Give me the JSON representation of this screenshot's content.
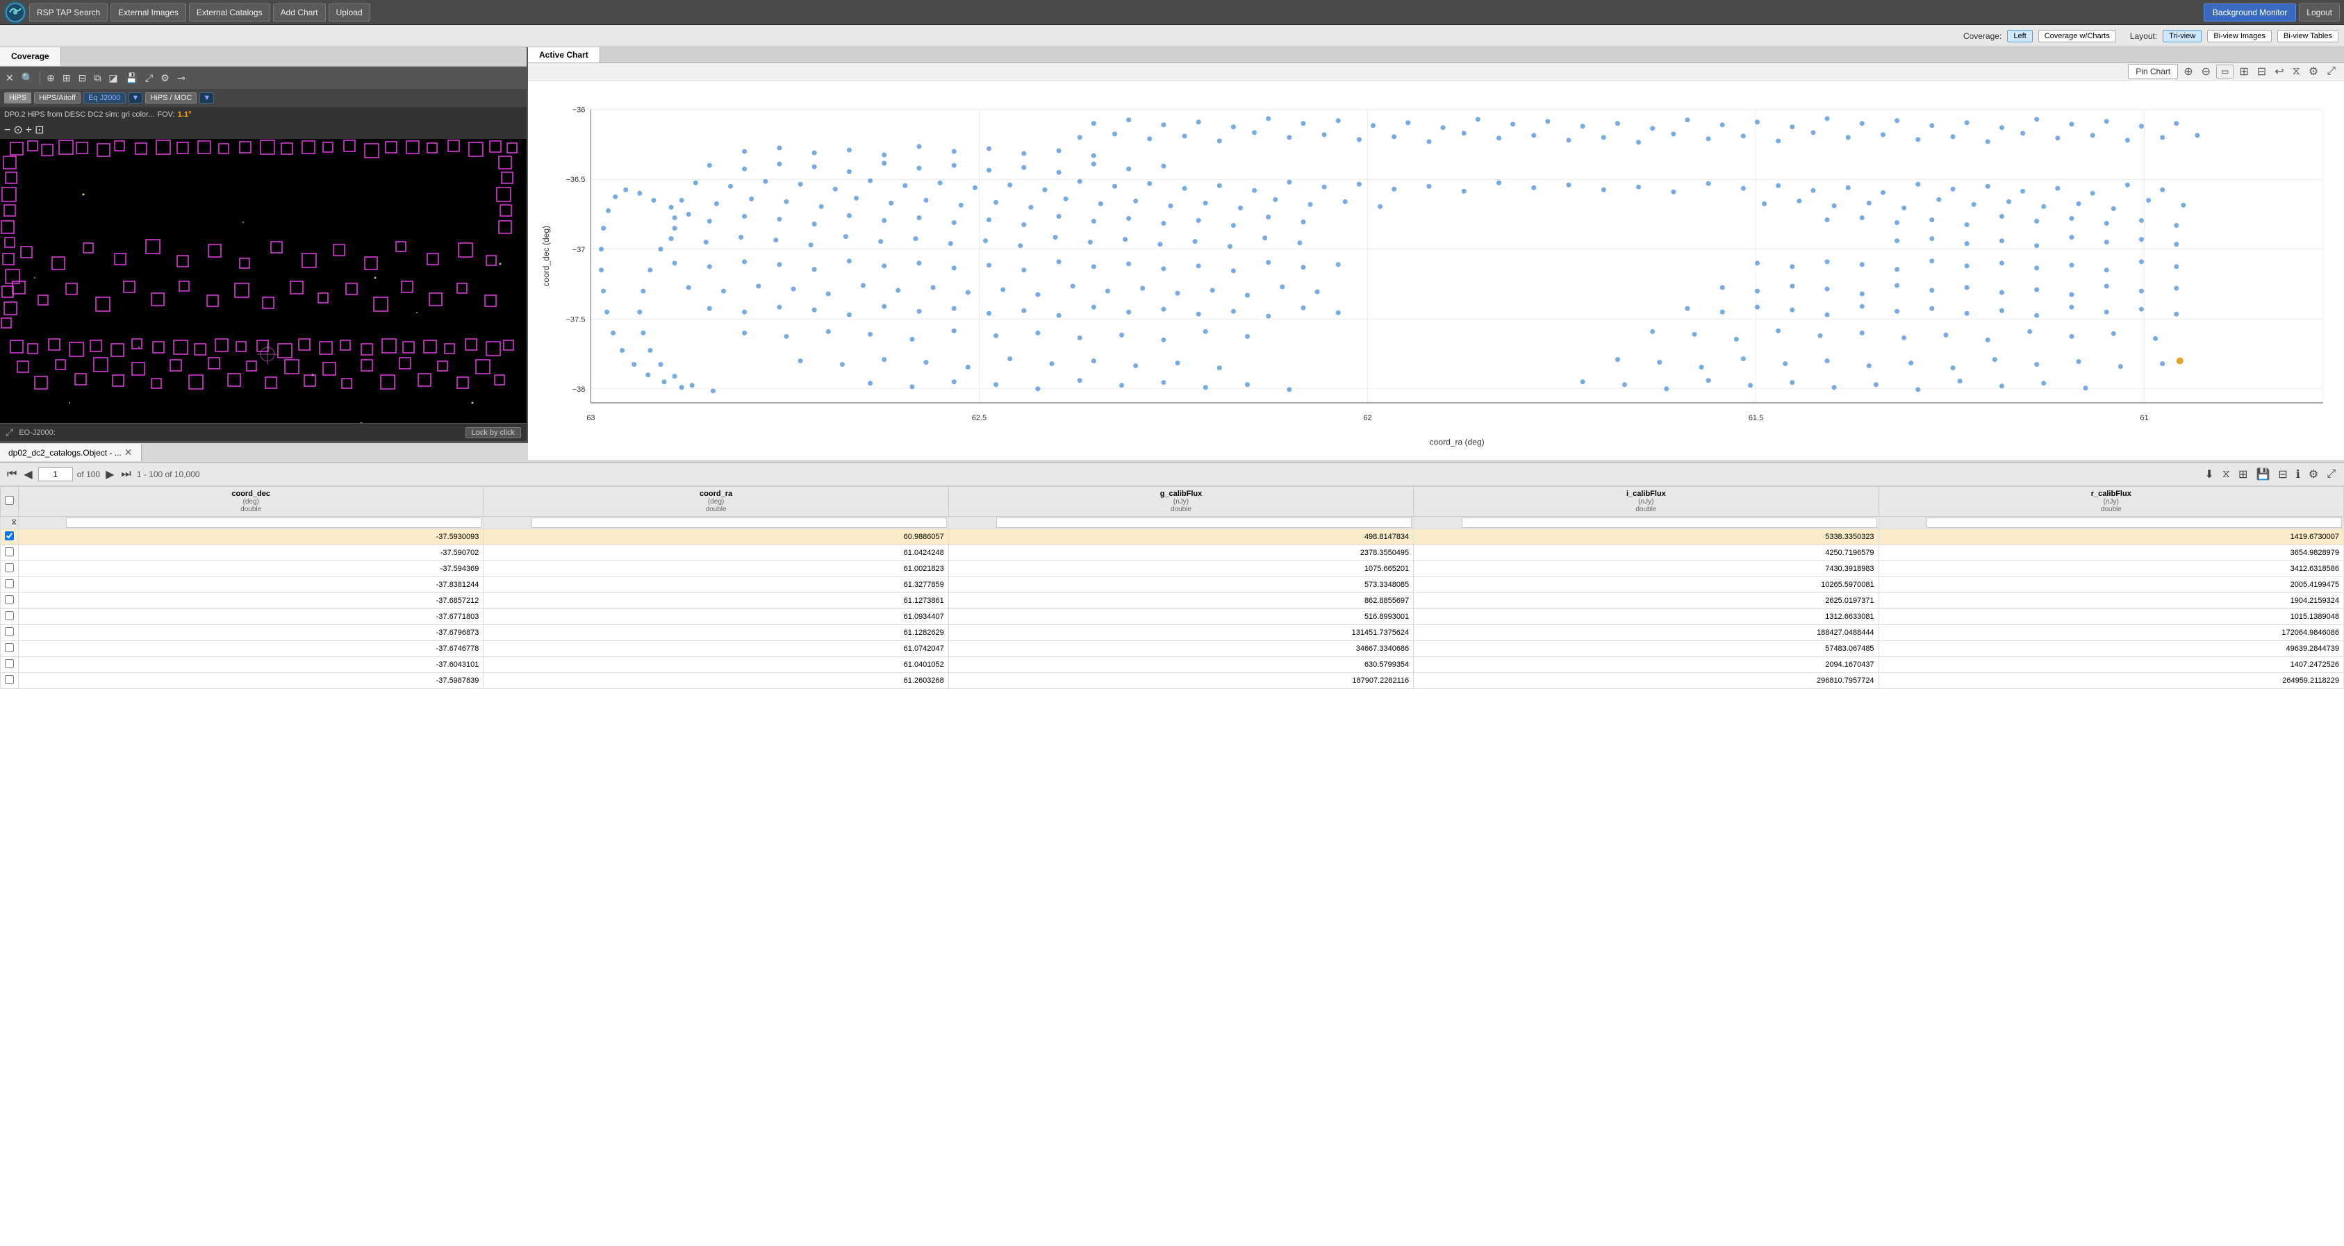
{
  "toolbar": {
    "logo_text": "~",
    "buttons": [
      "RSP TAP Search",
      "External Images",
      "External Catalogs",
      "Add Chart",
      "Upload"
    ],
    "bg_monitor": "Background Monitor",
    "logout": "Logout"
  },
  "toolbar2": {
    "coverage_label": "Coverage:",
    "coverage_options": [
      "Left",
      "Coverage w/Charts"
    ],
    "layout_label": "Layout:",
    "layout_options": [
      "Tri-view",
      "Bi-view Images",
      "Bi-view Tables"
    ],
    "active_coverage": "Left",
    "active_layout": "Tri-view"
  },
  "left_panel": {
    "tab_label": "Coverage",
    "hips_chips": [
      "HiPS",
      "HiPS/Aitoff"
    ],
    "coord_system": "Eq J2000",
    "coord_dropdown": true,
    "hips_moc": "HiPS / MOC",
    "fov_description": "DP0.2 HiPS from DESC DC2 sim: gri color...",
    "fov_label": "FOV:",
    "fov_value": "1.1°",
    "zoom_buttons": [
      "-",
      "◎",
      "+",
      "⊡"
    ],
    "status_coord_label": "EO-J2000:",
    "lock_btn": "Lock by click"
  },
  "right_panel": {
    "tab_label": "Active Chart",
    "pin_chart": "Pin Chart",
    "x_axis_title": "coord_ra (deg)",
    "y_axis_title": "coord_dec (deg)",
    "x_labels": [
      "63",
      "62.5",
      "62",
      "61.5",
      "61"
    ],
    "y_labels": [
      "-36",
      "-36.5",
      "-37",
      "-37.5",
      "-38"
    ],
    "chart_data_description": "scatter plot of coord_ra vs coord_dec"
  },
  "table_section": {
    "tab_label": "dp02_dc2_catalogs.Object - ...",
    "page_current": "1",
    "page_total": "100",
    "row_range": "1 - 100 of 10,000",
    "columns": [
      {
        "name": "coord_dec",
        "unit": "(deg)",
        "type": "double"
      },
      {
        "name": "coord_ra",
        "unit": "(deg)",
        "type": "double"
      },
      {
        "name": "g_calibFlux",
        "unit": "(nJy)",
        "type": "double"
      },
      {
        "name": "i_calibFlux",
        "unit": "(nJy)",
        "type": "double"
      },
      {
        "name": "r_calibFlux",
        "unit": "(nJy)",
        "type": "double"
      }
    ],
    "rows": [
      {
        "selected": true,
        "coord_dec": "-37.5930093",
        "coord_ra": "60.9886057",
        "g_calibFlux": "498.8147834",
        "i_calibFlux": "5338.3350323",
        "r_calibFlux": "1419.6730007"
      },
      {
        "selected": false,
        "coord_dec": "-37.590702",
        "coord_ra": "61.0424248",
        "g_calibFlux": "2378.3550495",
        "i_calibFlux": "4250.7196579",
        "r_calibFlux": "3654.9828979"
      },
      {
        "selected": false,
        "coord_dec": "-37.594369",
        "coord_ra": "61.0021823",
        "g_calibFlux": "1075.665201",
        "i_calibFlux": "7430.3918983",
        "r_calibFlux": "3412.6318586"
      },
      {
        "selected": false,
        "coord_dec": "-37.8381244",
        "coord_ra": "61.3277859",
        "g_calibFlux": "573.3348085",
        "i_calibFlux": "10265.5970081",
        "r_calibFlux": "2005.4199475"
      },
      {
        "selected": false,
        "coord_dec": "-37.6857212",
        "coord_ra": "61.1273861",
        "g_calibFlux": "862.8855697",
        "i_calibFlux": "2625.0197371",
        "r_calibFlux": "1904.2159324"
      },
      {
        "selected": false,
        "coord_dec": "-37.6771803",
        "coord_ra": "61.0934407",
        "g_calibFlux": "516.8993001",
        "i_calibFlux": "1312.6633081",
        "r_calibFlux": "1015.1389048"
      },
      {
        "selected": false,
        "coord_dec": "-37.6796873",
        "coord_ra": "61.1282629",
        "g_calibFlux": "131451.7375624",
        "i_calibFlux": "188427.0488444",
        "r_calibFlux": "172064.9846086"
      },
      {
        "selected": false,
        "coord_dec": "-37.6746778",
        "coord_ra": "61.0742047",
        "g_calibFlux": "34667.3340686",
        "i_calibFlux": "57483.067485",
        "r_calibFlux": "49639.2844739"
      },
      {
        "selected": false,
        "coord_dec": "-37.6043101",
        "coord_ra": "61.0401052",
        "g_calibFlux": "630.5799354",
        "i_calibFlux": "2094.1670437",
        "r_calibFlux": "1407.2472526"
      },
      {
        "selected": false,
        "coord_dec": "-37.5987839",
        "coord_ra": "61.2603268",
        "g_calibFlux": "187907.2282116",
        "i_calibFlux": "296810.7957724",
        "r_calibFlux": "264959.2118229"
      }
    ]
  }
}
